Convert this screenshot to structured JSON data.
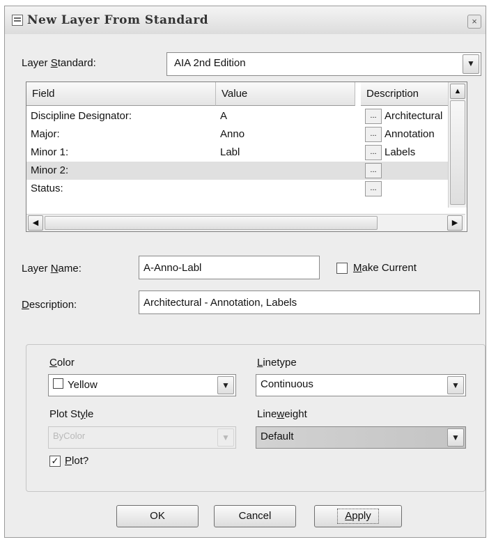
{
  "window": {
    "title": "New Layer From Standard",
    "close_glyph": "×"
  },
  "layer_standard": {
    "label": "Layer Standard:",
    "mnemonic": "S",
    "value": "AIA 2nd Edition"
  },
  "grid": {
    "columns": [
      "Field",
      "Value",
      "Description"
    ],
    "rows": [
      {
        "field": "Discipline Designator:",
        "value": "A",
        "description": "Architectural",
        "button": "..."
      },
      {
        "field": "Major:",
        "value": "Anno",
        "description": "Annotation",
        "button": "..."
      },
      {
        "field": "Minor 1:",
        "value": "Labl",
        "description": "Labels",
        "button": "..."
      },
      {
        "field": "Minor 2:",
        "value": "",
        "description": "",
        "button": "..."
      },
      {
        "field": "Status:",
        "value": "",
        "description": "",
        "button": "..."
      }
    ]
  },
  "layer_name": {
    "label": "Layer Name:",
    "mnemonic": "N",
    "value": "A-Anno-Labl"
  },
  "make_current": {
    "label": "Make Current",
    "mnemonic": "M",
    "checked": false
  },
  "description": {
    "label": "Description:",
    "mnemonic": "D",
    "value": "Architectural - Annotation, Labels"
  },
  "color": {
    "label": "Color",
    "mnemonic": "C",
    "value": "Yellow"
  },
  "linetype": {
    "label": "Linetype",
    "mnemonic": "L",
    "value": "Continuous"
  },
  "plot_style": {
    "label": "Plot Style",
    "mnemonic": "y",
    "value": "ByColor",
    "enabled": false
  },
  "lineweight": {
    "label": "Lineweight",
    "mnemonic": "w",
    "value": "Default"
  },
  "plot": {
    "label": "Plot?",
    "mnemonic": "P",
    "checked": true
  },
  "buttons": {
    "ok": "OK",
    "cancel": "Cancel",
    "apply": "Apply",
    "apply_mnemonic": "A"
  },
  "icons": {
    "dropdown": "chevron-down-icon",
    "scroll_up": "up-arrow-icon",
    "scroll_left": "left-arrow-icon",
    "scroll_right": "right-arrow-icon",
    "check": "checkmark-icon"
  }
}
